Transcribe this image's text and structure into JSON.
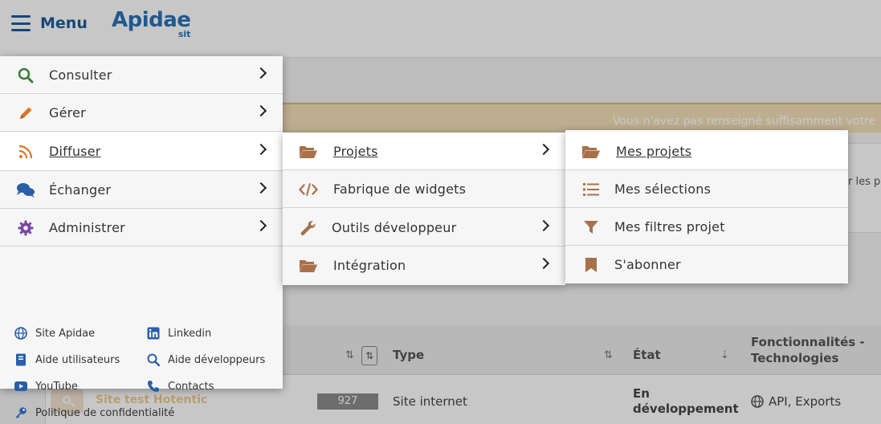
{
  "header": {
    "menu_label": "Menu",
    "logo_text": "Apidae",
    "logo_sub": "sit"
  },
  "warning": {
    "text": "Vous n'avez pas renseigné suffisamment votre"
  },
  "filter_fragment": "r les p",
  "table": {
    "headers": {
      "type": "Type",
      "etat": "État",
      "fonctionnalites_line1": "Fonctionnalités -",
      "fonctionnalites_line2": "Technologies"
    },
    "row": {
      "name": "Site test Hotentic",
      "id": "927",
      "type": "Site internet",
      "etat": "En développement",
      "fonctionnalites": "API, Exports"
    }
  },
  "main_menu": {
    "items": [
      {
        "label": "Consulter",
        "icon": "search-icon",
        "color": "#3a7d3a"
      },
      {
        "label": "Gérer",
        "icon": "pencil-icon",
        "color": "#d9772b"
      },
      {
        "label": "Diffuser",
        "icon": "rss-icon",
        "color": "#d9772b"
      },
      {
        "label": "Échanger",
        "icon": "comments-icon",
        "color": "#2a5ea8"
      },
      {
        "label": "Administrer",
        "icon": "gear-icon",
        "color": "#7a45a8"
      }
    ],
    "active_index": 2
  },
  "submenu_diffuser": {
    "items": [
      {
        "label": "Projets",
        "icon": "folder-open-icon",
        "has_children": true
      },
      {
        "label": "Fabrique de widgets",
        "icon": "code-icon",
        "has_children": false
      },
      {
        "label": "Outils développeur",
        "icon": "wrench-icon",
        "has_children": true
      },
      {
        "label": "Intégration",
        "icon": "folder-open-icon",
        "has_children": true
      }
    ],
    "active_index": 0
  },
  "submenu_projets": {
    "items": [
      {
        "label": "Mes projets",
        "icon": "folder-open-icon"
      },
      {
        "label": "Mes sélections",
        "icon": "list-icon"
      },
      {
        "label": "Mes filtres projet",
        "icon": "filter-icon"
      },
      {
        "label": "S'abonner",
        "icon": "bookmark-icon"
      }
    ],
    "active_index": 0
  },
  "footer_links": [
    {
      "label": "Site Apidae",
      "icon": "globe-icon"
    },
    {
      "label": "Linkedin",
      "icon": "linkedin-icon"
    },
    {
      "label": "Aide utilisateurs",
      "icon": "book-icon"
    },
    {
      "label": "Aide développeurs",
      "icon": "search-icon"
    },
    {
      "label": "YouTube",
      "icon": "youtube-icon"
    },
    {
      "label": "Contacts",
      "icon": "phone-icon"
    },
    {
      "label": "Politique de confidentialité",
      "icon": "key-icon"
    }
  ],
  "colors": {
    "brand_blue": "#1c5b9a",
    "brown_icon": "#a8714a",
    "link_icon_blue": "#2a5ea8",
    "warning_bg": "#f4dfb9"
  }
}
